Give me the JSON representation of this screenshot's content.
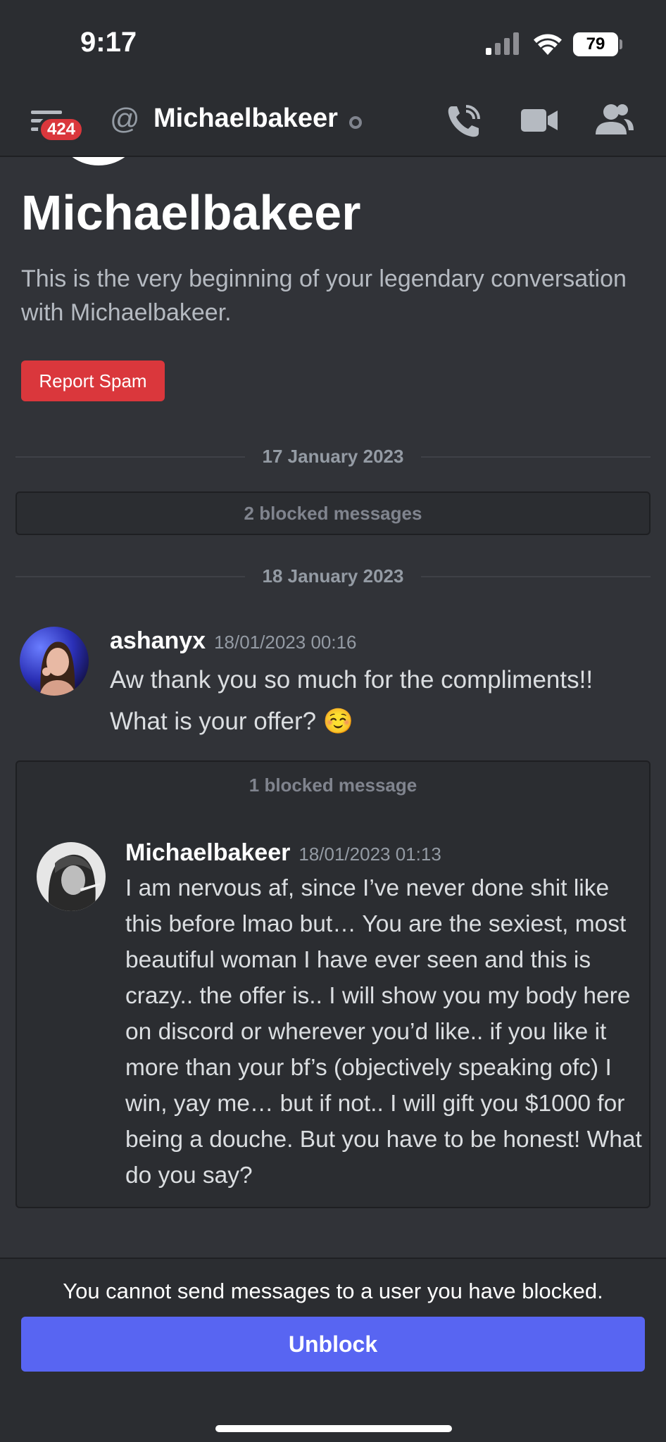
{
  "status_bar": {
    "time": "9:17",
    "battery": "79",
    "icons": [
      "signal-icon",
      "wifi-icon",
      "battery-icon"
    ]
  },
  "header": {
    "badge_count": "424",
    "title": "Michaelbakeer",
    "icons": [
      "menu-icon",
      "at-icon",
      "call-icon",
      "video-icon",
      "members-icon"
    ]
  },
  "intro": {
    "title": "Michaelbakeer",
    "text": "This is the very beginning of your legendary conversation with Michaelbakeer.",
    "report_label": "Report Spam"
  },
  "divider1": "17 January 2023",
  "blocked1": "2 blocked messages",
  "divider2": "18 January 2023",
  "message1": {
    "author": "ashanyx",
    "time": "18/01/2023 00:16",
    "line1": "Aw thank you so much for the compliments!!",
    "line2": "What is your offer? ☺️"
  },
  "blocked2": "1 blocked message",
  "message2": {
    "author": "Michaelbakeer",
    "time": "18/01/2023 01:13",
    "text": "I am nervous af, since I’ve never done shit like this before lmao but… You are the sexiest, most beautiful woman I have ever seen and this is crazy.. the offer is.. I will show you my body here on discord or wherever you’d like.. if you like it more than your bf’s (objectively speaking ofc) I win, yay me… but if not.. I will gift you $1000 for being a douche. But you have to be honest! What do you say?"
  },
  "footer": {
    "text": "You cannot send messages to a user you have blocked.",
    "unblock_label": "Unblock"
  },
  "colors": {
    "background": "#313338",
    "header": "#2b2d31",
    "danger": "#da373c",
    "blurple": "#5865f2"
  }
}
